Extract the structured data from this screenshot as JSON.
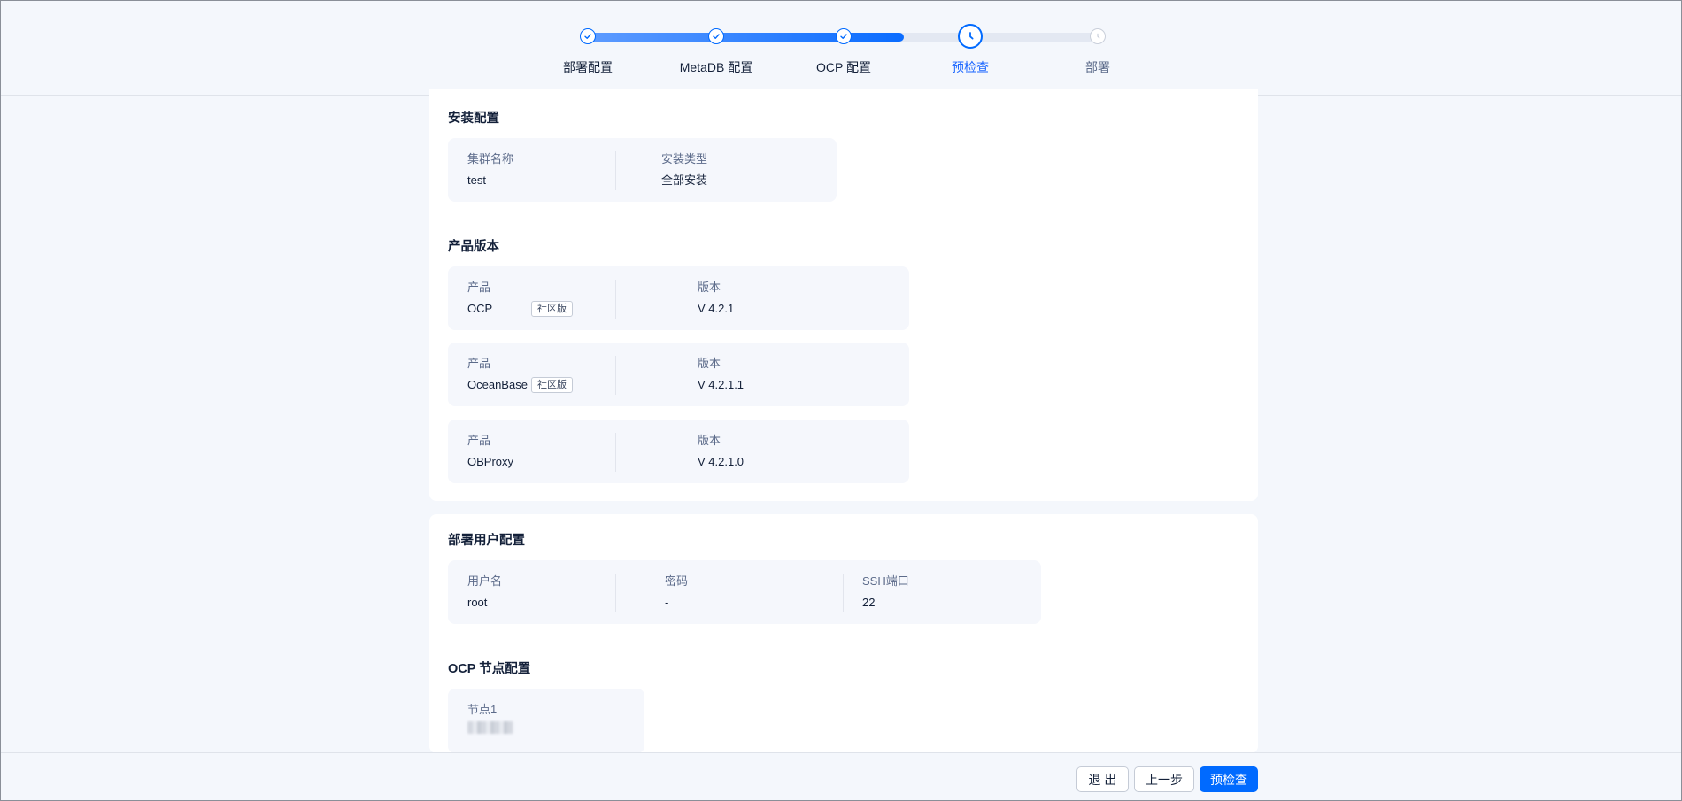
{
  "stepper": {
    "progress": 0.62,
    "steps": [
      {
        "label": "部署配置",
        "state": "done"
      },
      {
        "label": "MetaDB 配置",
        "state": "done"
      },
      {
        "label": "OCP 配置",
        "state": "done"
      },
      {
        "label": "预检查",
        "state": "current"
      },
      {
        "label": "部署",
        "state": "todo"
      }
    ]
  },
  "install_config": {
    "title": "安装配置",
    "cluster_name_label": "集群名称",
    "cluster_name": "test",
    "install_type_label": "安装类型",
    "install_type": "全部安装"
  },
  "product_versions": {
    "title": "产品版本",
    "rows": [
      {
        "product_label": "产品",
        "product": "OCP",
        "tag": "社区版",
        "version_label": "版本",
        "version": "V 4.2.1"
      },
      {
        "product_label": "产品",
        "product": "OceanBase",
        "tag": "社区版",
        "version_label": "版本",
        "version": "V 4.2.1.1"
      },
      {
        "product_label": "产品",
        "product": "OBProxy",
        "tag": "",
        "version_label": "版本",
        "version": "V 4.2.1.0"
      }
    ]
  },
  "deploy_user": {
    "title": "部署用户配置",
    "username_label": "用户名",
    "username": "root",
    "password_label": "密码",
    "password": "-",
    "ssh_port_label": "SSH端口",
    "ssh_port": "22"
  },
  "ocp_nodes": {
    "title": "OCP 节点配置",
    "node_label": "节点1"
  },
  "footer": {
    "exit_label": "退 出",
    "prev_label": "上一步",
    "precheck_label": "预检查"
  },
  "colors": {
    "primary": "#006aff",
    "background": "#f4f7fc",
    "card": "#ffffff",
    "info_box": "#f5f7fc"
  }
}
